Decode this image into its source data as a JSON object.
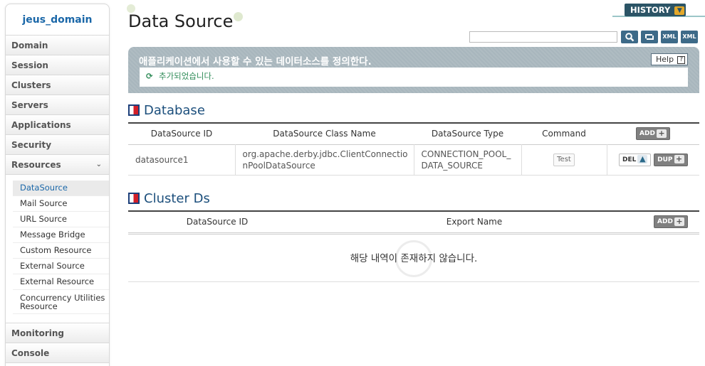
{
  "app": {
    "domain": "jeus_domain",
    "page_title": "Data Source",
    "history_label": "HISTORY"
  },
  "sidebar": {
    "items_top": [
      {
        "label": "Domain"
      },
      {
        "label": "Session"
      },
      {
        "label": "Clusters"
      },
      {
        "label": "Servers"
      },
      {
        "label": "Applications"
      },
      {
        "label": "Security"
      },
      {
        "label": "Resources"
      }
    ],
    "resources_sub": [
      {
        "label": "DataSource"
      },
      {
        "label": "Mail Source"
      },
      {
        "label": "URL Source"
      },
      {
        "label": "Message Bridge"
      },
      {
        "label": "Custom Resource"
      },
      {
        "label": "External Source"
      },
      {
        "label": "External Resource"
      },
      {
        "label": "Concurrency Utilities Resource"
      }
    ],
    "items_bottom": [
      {
        "label": "Monitoring"
      },
      {
        "label": "Console"
      }
    ]
  },
  "toolbar": {
    "search_placeholder": "",
    "xml_label": "XML"
  },
  "info": {
    "description": "애플리케이션에서 사용할 수 있는 데이터소스를 정의한다.",
    "help_label": "Help",
    "help_q": "?",
    "message": "추가되었습니다."
  },
  "database": {
    "title": "Database",
    "columns": [
      "DataSource ID",
      "DataSource Class Name",
      "DataSource Type",
      "Command"
    ],
    "add_label": "ADD",
    "rows": [
      {
        "id": "datasource1",
        "class_name": "org.apache.derby.jdbc.ClientConnectionPoolDataSource",
        "type": "CONNECTION_POOL_DATA_SOURCE",
        "test_label": "Test",
        "del_label": "DEL",
        "dup_label": "DUP"
      }
    ]
  },
  "cluster_ds": {
    "title": "Cluster Ds",
    "columns": [
      "DataSource ID",
      "Export Name"
    ],
    "add_label": "ADD",
    "empty_message": "해당 내역이 존재하지 않습니다."
  },
  "colors": {
    "accent_blue": "#1a67a8",
    "section_blue": "#1c4f7c",
    "info_bg": "#a8b6bd",
    "history_bg": "#2b5466",
    "success_green": "#2e8b57"
  }
}
